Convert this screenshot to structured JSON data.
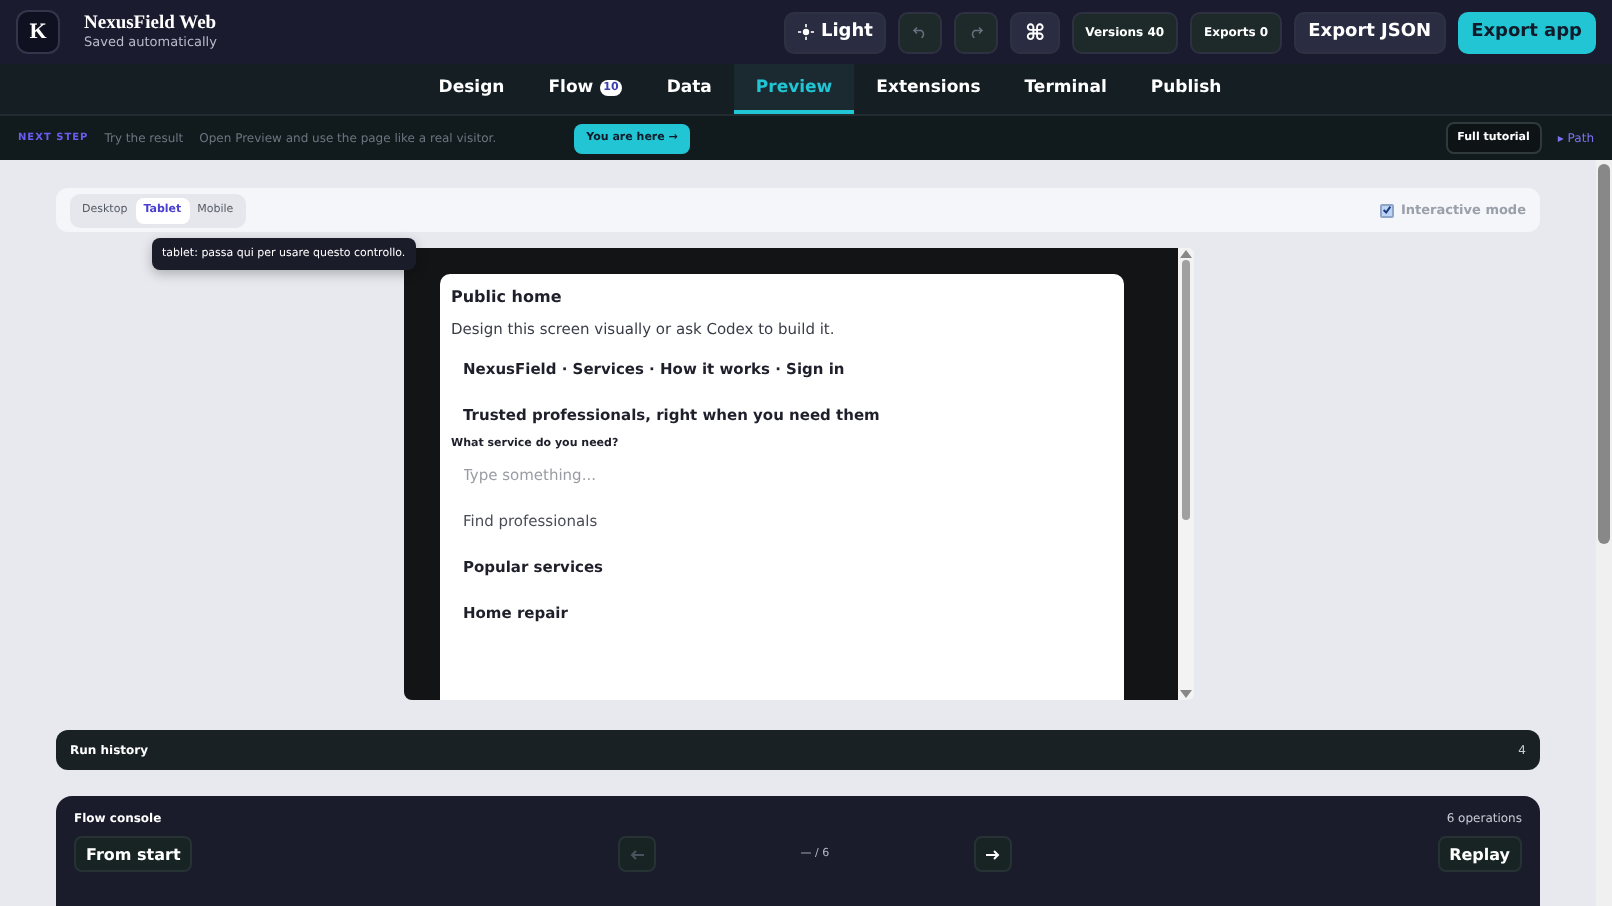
{
  "app": {
    "logo": "K",
    "title": "NexusField Web",
    "subtitle": "Saved automatically"
  },
  "header_actions": {
    "theme": "Light",
    "command": "⌘",
    "versions": "Versions 40",
    "exports": "Exports 0",
    "export_json": "Export JSON",
    "export_app": "Export app"
  },
  "tabs": [
    {
      "label": "Design",
      "selected": false
    },
    {
      "label": "Flow",
      "badge": "10",
      "selected": false
    },
    {
      "label": "Data",
      "selected": false
    },
    {
      "label": "Preview",
      "selected": true
    },
    {
      "label": "Extensions",
      "selected": false
    },
    {
      "label": "Terminal",
      "selected": false
    },
    {
      "label": "Publish",
      "selected": false
    }
  ],
  "next_step": {
    "tag": "NEXT STEP",
    "title": "Try the result",
    "text": "Open Preview and use the page like a real visitor.",
    "here": "You are here →",
    "tutorial": "Full tutorial",
    "path": "▸ Path"
  },
  "devices": [
    {
      "label": "Desktop",
      "selected": false
    },
    {
      "label": "Tablet",
      "selected": true
    },
    {
      "label": "Mobile",
      "selected": false
    }
  ],
  "tooltip": "tablet: passa qui per usare questo controllo.",
  "interactive_mode": {
    "label": "Interactive mode",
    "checked": true
  },
  "preview": [
    {
      "kind": "title",
      "text": "Public home"
    },
    {
      "kind": "text",
      "text": "Design this screen visually or ask Codex to build it."
    },
    {
      "kind": "strong",
      "text": "NexusField · Services · How it works · Sign in"
    },
    {
      "kind": "strong",
      "text": "Trusted professionals, right when you need them"
    },
    {
      "kind": "label",
      "text": "What service do you need?"
    },
    {
      "kind": "input",
      "placeholder": "Type something..."
    },
    {
      "kind": "button",
      "text": "Find professionals"
    },
    {
      "kind": "strong",
      "text": "Popular services"
    },
    {
      "kind": "strong",
      "text": "Home repair"
    }
  ],
  "run_history": {
    "title": "Run history",
    "count": "4"
  },
  "flow_console": {
    "title": "Flow console",
    "operations": "6 operations",
    "from_start": "From start",
    "position": "— / 6",
    "replay": "Replay",
    "prev_disabled": true,
    "next_disabled": false
  }
}
